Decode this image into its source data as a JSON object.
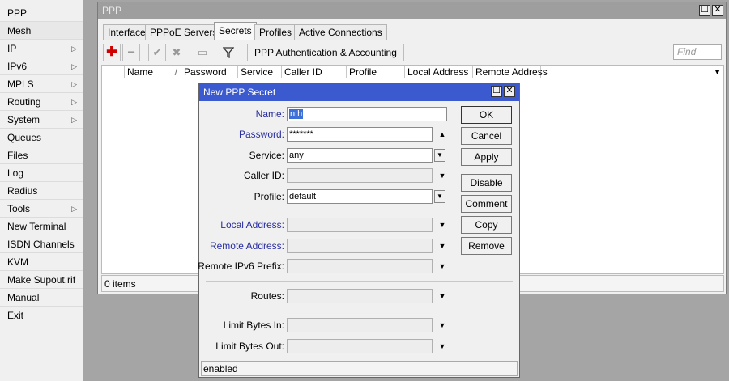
{
  "sidebar": {
    "items": [
      {
        "label": "PPP",
        "submenu": false
      },
      {
        "label": "Mesh",
        "submenu": false
      },
      {
        "label": "IP",
        "submenu": true
      },
      {
        "label": "IPv6",
        "submenu": true
      },
      {
        "label": "MPLS",
        "submenu": true
      },
      {
        "label": "Routing",
        "submenu": true
      },
      {
        "label": "System",
        "submenu": true
      },
      {
        "label": "Queues",
        "submenu": false
      },
      {
        "label": "Files",
        "submenu": false
      },
      {
        "label": "Log",
        "submenu": false
      },
      {
        "label": "Radius",
        "submenu": false
      },
      {
        "label": "Tools",
        "submenu": true
      },
      {
        "label": "New Terminal",
        "submenu": false
      },
      {
        "label": "ISDN Channels",
        "submenu": false
      },
      {
        "label": "KVM",
        "submenu": false
      },
      {
        "label": "Make Supout.rif",
        "submenu": false
      },
      {
        "label": "Manual",
        "submenu": false
      },
      {
        "label": "Exit",
        "submenu": false
      }
    ],
    "submenu_arrow": "▷"
  },
  "ppp_window": {
    "title": "PPP",
    "tabs": [
      "Interface",
      "PPPoE Servers",
      "Secrets",
      "Profiles",
      "Active Connections"
    ],
    "active_tab": "Secrets",
    "toolbar": {
      "add_icon": "plus-icon",
      "remove_icon": "minus-icon",
      "enable_icon": "check-icon",
      "disable_icon": "cross-icon",
      "comment_icon": "comment-icon",
      "filter_icon": "filter-icon",
      "auth_button": "PPP Authentication & Accounting",
      "find_placeholder": "Find"
    },
    "columns": [
      "Name",
      "Password",
      "Service",
      "Caller ID",
      "Profile",
      "Local Address",
      "Remote Address"
    ],
    "sort_indicator": "/",
    "status": "0 items"
  },
  "dialog": {
    "title": "New PPP Secret",
    "fields": {
      "name": {
        "label": "Name:",
        "value": "nth"
      },
      "password": {
        "label": "Password:",
        "value": "*******"
      },
      "service": {
        "label": "Service:",
        "value": "any"
      },
      "caller_id": {
        "label": "Caller ID:",
        "value": ""
      },
      "profile": {
        "label": "Profile:",
        "value": "default"
      },
      "local_address": {
        "label": "Local Address:",
        "value": ""
      },
      "remote_address": {
        "label": "Remote Address:",
        "value": ""
      },
      "remote_ipv6_prefix": {
        "label": "Remote IPv6 Prefix:",
        "value": ""
      },
      "routes": {
        "label": "Routes:",
        "value": ""
      },
      "limit_bytes_in": {
        "label": "Limit Bytes In:",
        "value": ""
      },
      "limit_bytes_out": {
        "label": "Limit Bytes Out:",
        "value": ""
      }
    },
    "buttons": {
      "ok": "OK",
      "cancel": "Cancel",
      "apply": "Apply",
      "disable": "Disable",
      "comment": "Comment",
      "copy": "Copy",
      "remove": "Remove"
    },
    "status": "enabled"
  },
  "colors": {
    "dialog_titlebar": "#3c5ad0",
    "blue_label": "#2a2fa0",
    "add_icon": "#d00000"
  }
}
